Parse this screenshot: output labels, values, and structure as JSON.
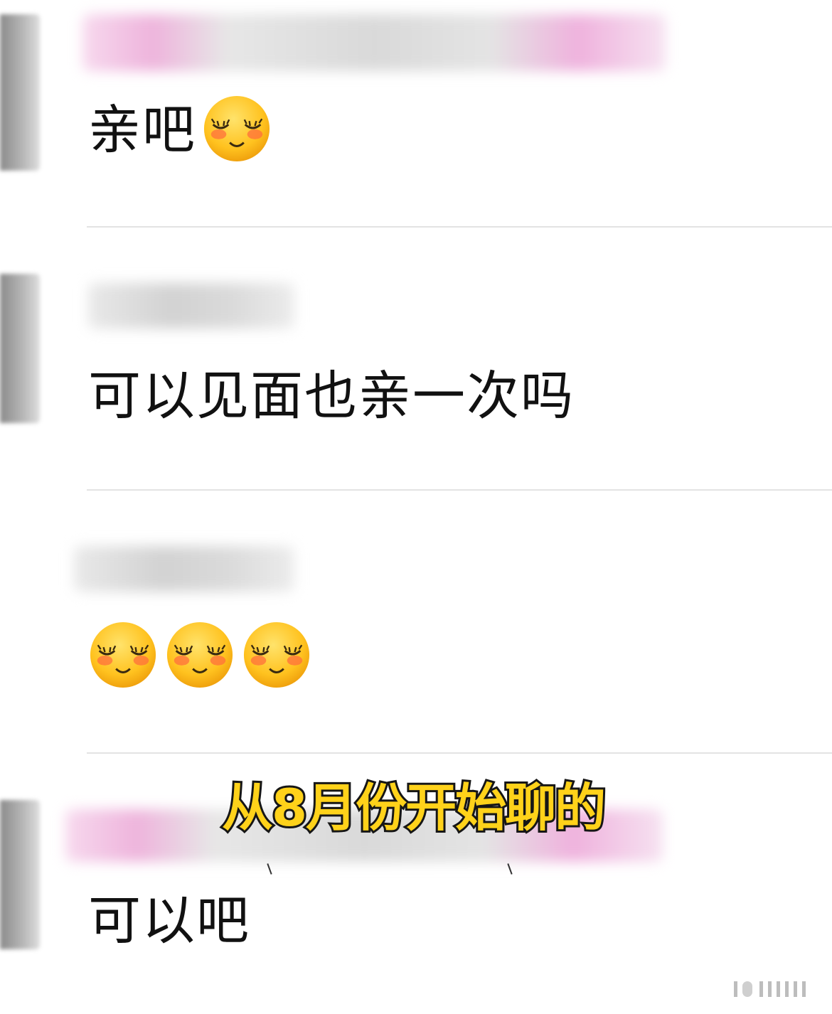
{
  "messages": [
    {
      "text": "亲吧",
      "emoji": [
        "smiling-blush-eyes-closed-icon"
      ]
    },
    {
      "text": "可以见面也亲一次吗",
      "emoji": []
    },
    {
      "text": "",
      "emoji": [
        "smiling-blush-eyes-closed-icon",
        "smiling-blush-eyes-closed-icon",
        "smiling-blush-eyes-closed-icon"
      ]
    },
    {
      "text": "可以吧",
      "emoji": []
    }
  ],
  "overlay": {
    "subtitle": "从8月份开始聊的",
    "subtitle_color": "#ffd21a"
  },
  "colors": {
    "background": "#ffffff",
    "divider": "#e3e3e3",
    "text": "#111111"
  }
}
